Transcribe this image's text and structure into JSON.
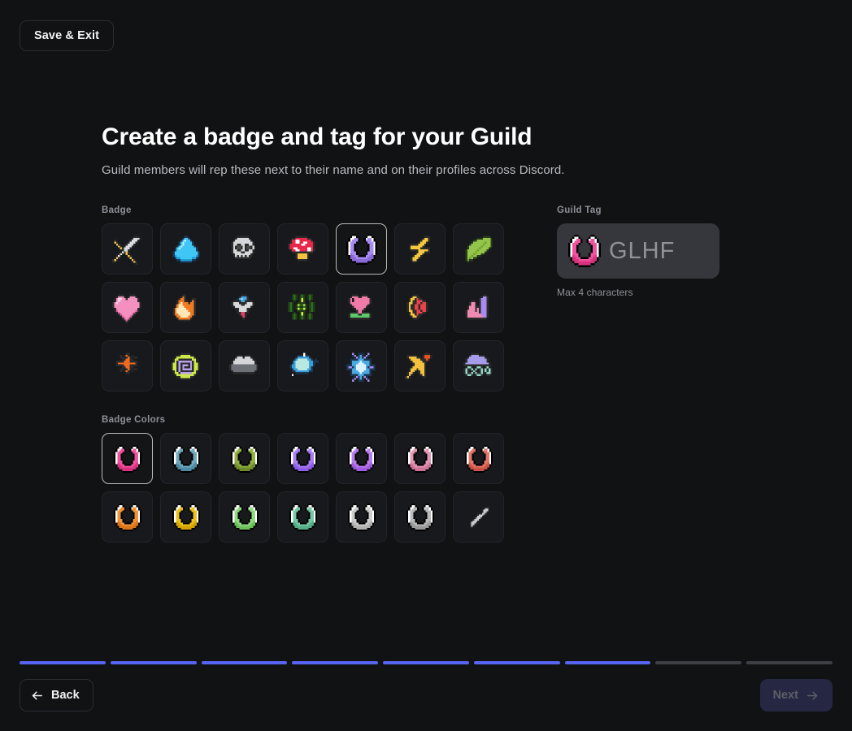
{
  "header": {
    "save_exit_label": "Save & Exit"
  },
  "main": {
    "title": "Create a badge and tag for your Guild",
    "subtitle": "Guild members will rep these next to their name and on their profiles across Discord."
  },
  "badge_section": {
    "label": "Badge",
    "selected_index": 4,
    "items": [
      {
        "name": "crossed-swords-badge",
        "icon": "crossed-swords"
      },
      {
        "name": "water-droplet-badge",
        "icon": "water-droplet"
      },
      {
        "name": "skull-badge",
        "icon": "skull"
      },
      {
        "name": "mushroom-badge",
        "icon": "mushroom"
      },
      {
        "name": "crescent-moon-badge",
        "icon": "crescent-moon"
      },
      {
        "name": "lightning-bolt-badge",
        "icon": "lightning-bolt"
      },
      {
        "name": "leaf-badge",
        "icon": "leaf"
      },
      {
        "name": "heart-badge",
        "icon": "heart"
      },
      {
        "name": "flame-badge",
        "icon": "flame"
      },
      {
        "name": "gem-diamond-badge",
        "icon": "gem-diamond"
      },
      {
        "name": "sun-burst-badge",
        "icon": "sun-burst"
      },
      {
        "name": "flower-heart-badge",
        "icon": "flower-heart"
      },
      {
        "name": "rainbow-moons-badge",
        "icon": "rainbow-moons"
      },
      {
        "name": "crystal-cluster-badge",
        "icon": "crystal-cluster"
      },
      {
        "name": "sparkle-star-badge",
        "icon": "sparkle-star"
      },
      {
        "name": "spiral-swirl-badge",
        "icon": "spiral-swirl"
      },
      {
        "name": "storm-cloud-badge",
        "icon": "storm-cloud"
      },
      {
        "name": "planet-orb-badge",
        "icon": "planet-orb"
      },
      {
        "name": "snowflake-badge",
        "icon": "snowflake"
      },
      {
        "name": "shooting-star-badge",
        "icon": "shooting-star"
      },
      {
        "name": "wind-cloud-badge",
        "icon": "wind-cloud"
      }
    ]
  },
  "colors_section": {
    "label": "Badge Colors",
    "selected_index": 0,
    "swatches": [
      {
        "name": "color-pink",
        "hex": "#f0529f",
        "shade": "#d8337f"
      },
      {
        "name": "color-teal-blue",
        "hex": "#6fa8bd",
        "shade": "#4c8ba3"
      },
      {
        "name": "color-olive-green",
        "hex": "#8fb03f",
        "shade": "#6f8c2c"
      },
      {
        "name": "color-purple",
        "hex": "#a87cf5",
        "shade": "#8f5dea"
      },
      {
        "name": "color-violet",
        "hex": "#b97ced",
        "shade": "#a05ade"
      },
      {
        "name": "color-rose-pink",
        "hex": "#e496b4",
        "shade": "#cf7499"
      },
      {
        "name": "color-salmon-red",
        "hex": "#e2766a",
        "shade": "#cc5447"
      },
      {
        "name": "color-orange",
        "hex": "#f09236",
        "shade": "#dc7418"
      },
      {
        "name": "color-gold-yellow",
        "hex": "#edc01a",
        "shade": "#d3a504"
      },
      {
        "name": "color-light-green",
        "hex": "#8ed87f",
        "shade": "#6cc05b"
      },
      {
        "name": "color-mint-green",
        "hex": "#76c8a5",
        "shade": "#54ad87"
      },
      {
        "name": "color-light-gray",
        "hex": "#cccccc",
        "shade": "#b0b0b0"
      },
      {
        "name": "color-silver-gray",
        "hex": "#b9b9b9",
        "shade": "#9a9a9a"
      }
    ],
    "eyedropper": {
      "name": "eyedropper-custom-color",
      "icon": "eyedropper"
    }
  },
  "guild_tag": {
    "label": "Guild Tag",
    "value": "GLHF",
    "placeholder": "GLHF",
    "badge_color": "#f0529f",
    "badge_shade": "#d8337f",
    "hint": "Max 4 characters"
  },
  "footer": {
    "progress": {
      "total": 9,
      "filled": 7,
      "fill_color": "#5865f2",
      "track_color": "#3d3f44"
    },
    "back_label": "Back",
    "next_label": "Next"
  }
}
